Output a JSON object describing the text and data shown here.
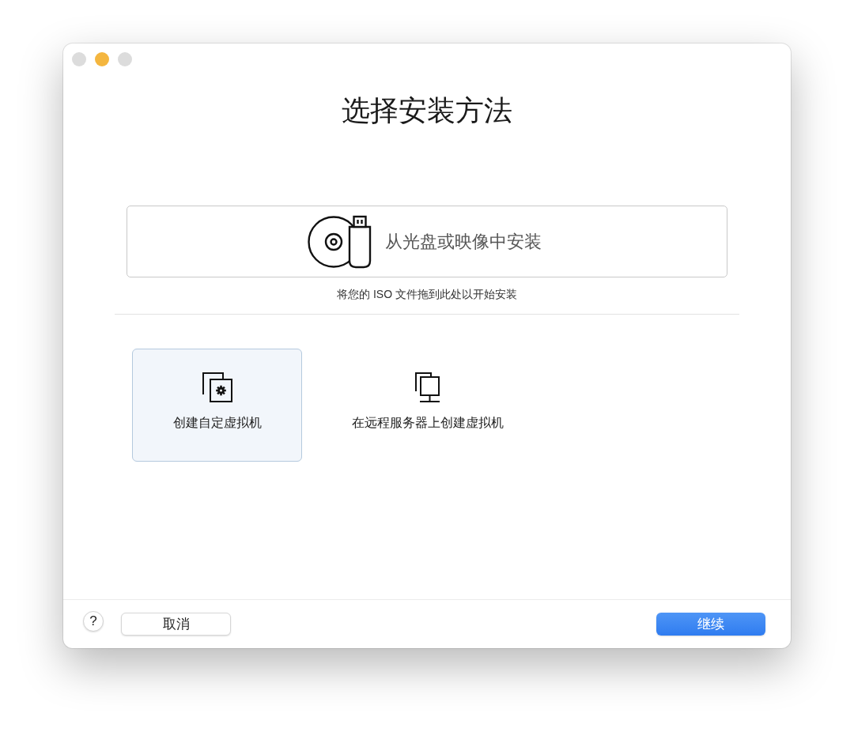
{
  "window": {
    "controls": [
      {
        "color": "#dcdcdc"
      },
      {
        "color": "#f4b63f"
      },
      {
        "color": "#dcdcdc"
      }
    ]
  },
  "heading": "选择安装方法",
  "install_drop": {
    "label": "从光盘或映像中安装",
    "hint": "将您的 ISO 文件拖到此处以开始安装"
  },
  "options": [
    {
      "kind": "custom",
      "label": "创建自定虚拟机",
      "selected": true
    },
    {
      "kind": "remote",
      "label": "在远程服务器上创建虚拟机",
      "selected": false
    }
  ],
  "footer": {
    "help": "?",
    "buttons": [
      {
        "kind": "secondary",
        "label": "取消"
      },
      {
        "kind": "primary",
        "label": "继续"
      }
    ]
  }
}
